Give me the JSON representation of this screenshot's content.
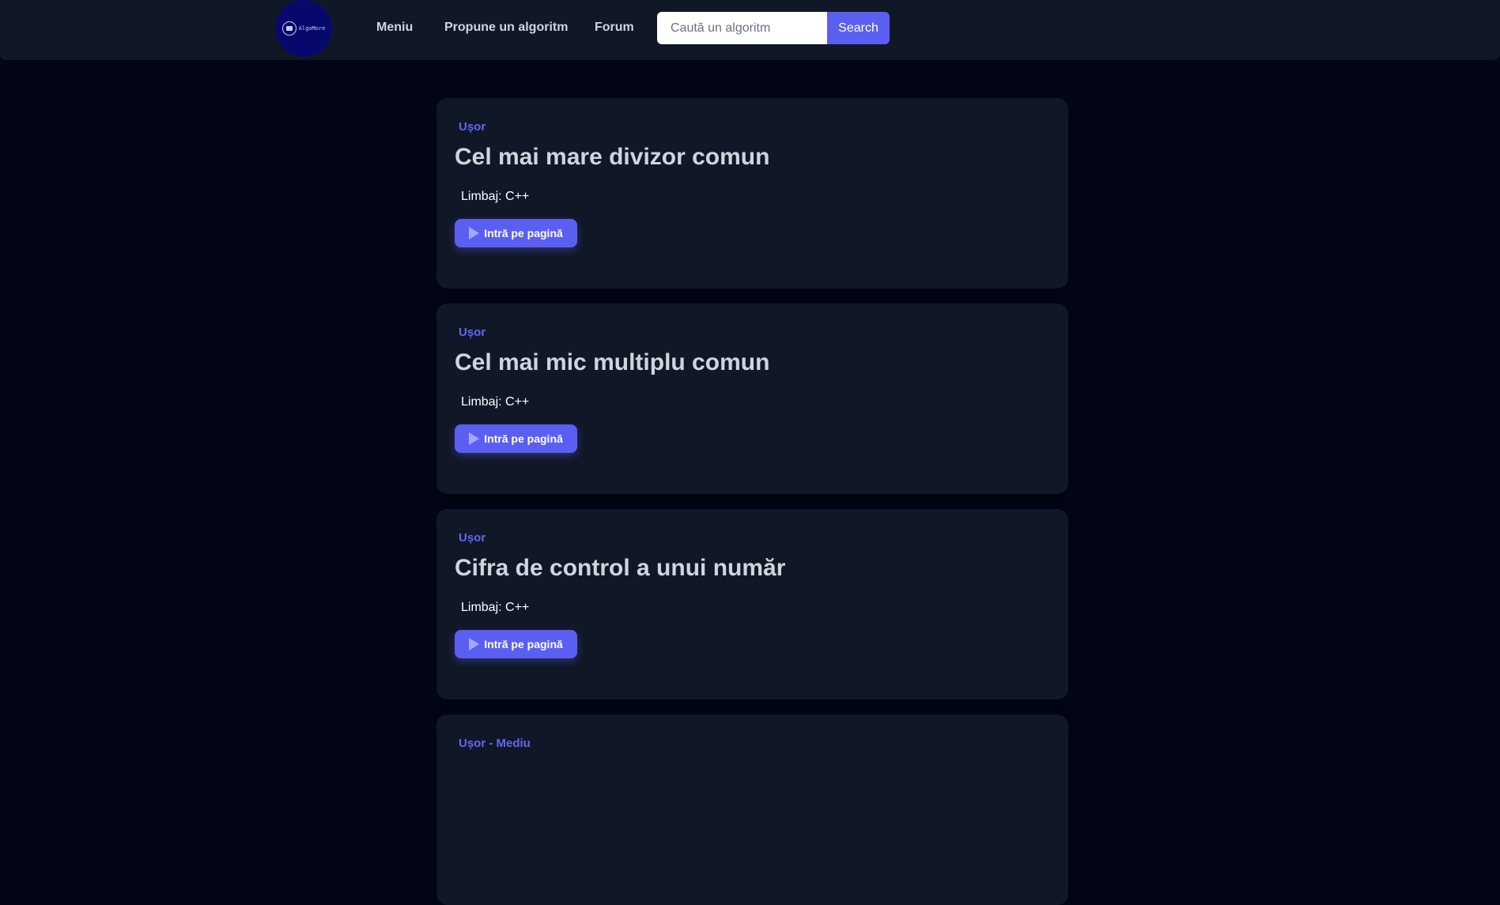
{
  "header": {
    "logo_text": "AlgoMore",
    "nav": {
      "menu": "Meniu",
      "propose": "Propune un algoritm",
      "forum": "Forum"
    },
    "search": {
      "placeholder": "Caută un algoritm",
      "value": "",
      "button_label": "Search"
    }
  },
  "icons": {
    "logo": "book-icon",
    "enter": "play-icon"
  },
  "colors": {
    "accent": "#5b5ff1",
    "badge": "#6366f1",
    "background": "#030617",
    "card": "#101827"
  },
  "algorithms": [
    {
      "difficulty": "Ușor",
      "title": "Cel mai mare divizor comun",
      "language": "Limbaj: C++",
      "button_label": "Intră pe pagină"
    },
    {
      "difficulty": "Ușor",
      "title": "Cel mai mic multiplu comun",
      "language": "Limbaj: C++",
      "button_label": "Intră pe pagină"
    },
    {
      "difficulty": "Ușor",
      "title": "Cifra de control a unui număr",
      "language": "Limbaj: C++",
      "button_label": "Intră pe pagină"
    },
    {
      "difficulty": "Ușor - Mediu",
      "title": "",
      "language": "",
      "button_label": ""
    }
  ]
}
